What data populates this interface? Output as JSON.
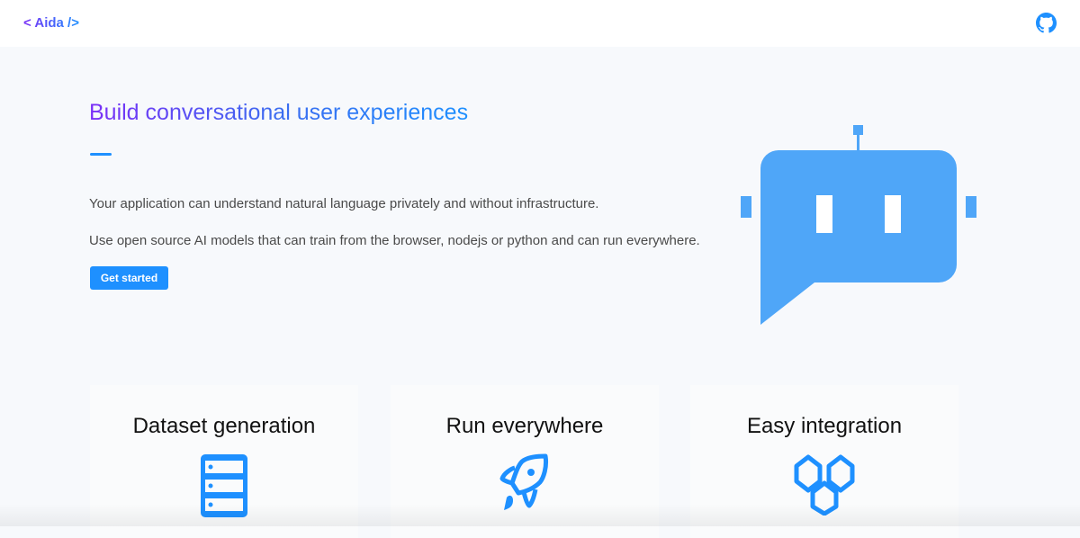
{
  "header": {
    "logo": "< Aida />",
    "github_icon": "github-icon"
  },
  "hero": {
    "title": "Build conversational user experiences",
    "paragraphs": [
      "Your application can understand natural language privately and without infrastructure.",
      "Use open source AI models that can train from the browser, nodejs or python and can run everywhere."
    ],
    "cta_label": "Get started",
    "illustration": "robot-chat-bubble"
  },
  "features": [
    {
      "title": "Dataset generation",
      "icon": "database-icon"
    },
    {
      "title": "Run everywhere",
      "icon": "rocket-icon"
    },
    {
      "title": "Easy integration",
      "icon": "hexagons-icon"
    }
  ],
  "colors": {
    "accent": "#1e90ff",
    "gradient_start": "#7b2ff7",
    "robot": "#4fa6f8",
    "background": "#f7f9fc"
  }
}
